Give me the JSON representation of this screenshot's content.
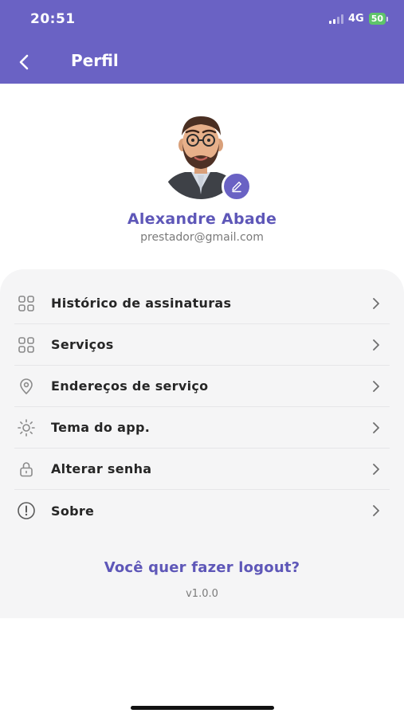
{
  "status_bar": {
    "time": "20:51",
    "network": "4G",
    "battery": "50"
  },
  "header": {
    "title": "Perfil",
    "back_icon": "chevron-left-icon"
  },
  "profile": {
    "name": "Alexandre Abade",
    "email": "prestador@gmail.com",
    "edit_icon": "pencil-icon"
  },
  "menu": {
    "items": [
      {
        "label": "Histórico de assinaturas",
        "icon": "grid-icon"
      },
      {
        "label": "Serviços",
        "icon": "grid-icon"
      },
      {
        "label": "Endereços de serviço",
        "icon": "location-pin-icon"
      },
      {
        "label": "Tema do app.",
        "icon": "sun-icon"
      },
      {
        "label": "Alterar senha",
        "icon": "lock-icon"
      },
      {
        "label": "Sobre",
        "icon": "info-icon"
      }
    ]
  },
  "footer": {
    "logout_label": "Você quer fazer logout?",
    "version": "v1.0.0"
  },
  "colors": {
    "primary": "#6a62c4",
    "accent_text": "#5e57b8",
    "card_bg": "#f5f5f6",
    "battery": "#5ec46a"
  }
}
